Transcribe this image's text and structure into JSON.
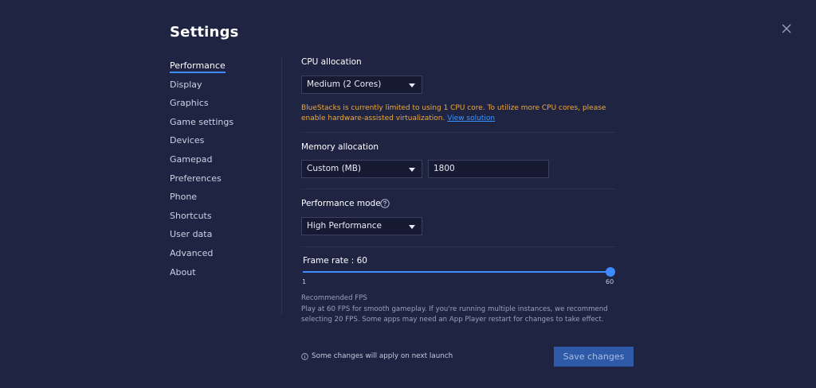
{
  "window": {
    "title": "Settings"
  },
  "sidebar": {
    "items": [
      {
        "label": "Performance",
        "active": true
      },
      {
        "label": "Display"
      },
      {
        "label": "Graphics"
      },
      {
        "label": "Game settings"
      },
      {
        "label": "Devices"
      },
      {
        "label": "Gamepad"
      },
      {
        "label": "Preferences"
      },
      {
        "label": "Phone"
      },
      {
        "label": "Shortcuts"
      },
      {
        "label": "User data"
      },
      {
        "label": "Advanced"
      },
      {
        "label": "About"
      }
    ]
  },
  "performance": {
    "cpu": {
      "label": "CPU allocation",
      "selected": "Medium (2 Cores)",
      "warning": "BlueStacks is currently limited to using 1 CPU core. To utilize more CPU cores, please enable hardware-assisted virtualization.",
      "warning_link": "View solution"
    },
    "memory": {
      "label": "Memory allocation",
      "selected": "Custom (MB)",
      "value": "1800"
    },
    "mode": {
      "label": "Performance mode",
      "selected": "High Performance"
    },
    "frame_rate": {
      "label": "Frame rate : 60",
      "min_label": "1",
      "max_label": "60",
      "min": 1,
      "max": 60,
      "value": 60,
      "recommended_title": "Recommended FPS",
      "recommended_text_1": "Play at 60 FPS for smooth gameplay. If you're running multiple instances, we recommend",
      "recommended_text_2": "selecting 20 FPS. Some apps may need an App Player restart for changes to take effect."
    }
  },
  "footer": {
    "note": "Some changes will apply on next launch",
    "save_label": "Save changes"
  },
  "colors": {
    "background": "#1f2442",
    "accent": "#3d8bff",
    "warning": "#f0a93b",
    "save_button": "#2f5aa8"
  }
}
